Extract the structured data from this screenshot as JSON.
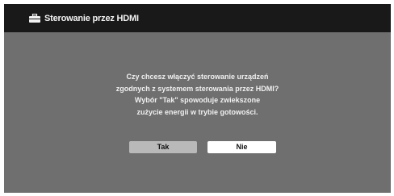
{
  "dialog": {
    "title": "Sterowanie przez HDMI",
    "title_icon": "toolbox-icon",
    "message_lines": [
      "Czy chcesz włączyć sterowanie urządzeń",
      "zgodnych z systemem sterowania przez HDMI?",
      "Wybór \"Tak\" spowoduje zwiekszone",
      "zużycie energii w trybie gotowości."
    ],
    "yes_label": "Tak",
    "no_label": "Nie"
  },
  "colors": {
    "background": "#6f6f6f",
    "title_bar": "#191919",
    "yes_button": "#b9b9b9",
    "no_button": "#ffffff"
  }
}
